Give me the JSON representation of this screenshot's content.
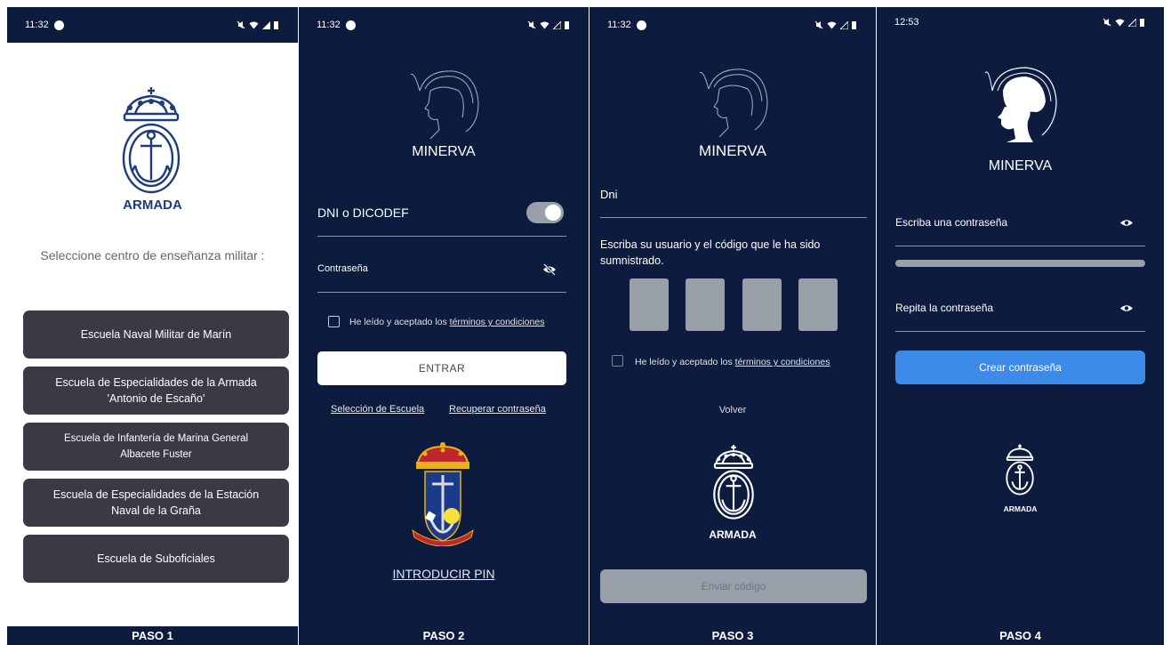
{
  "panels": {
    "p1": {
      "time": "11:32",
      "logo_text": "ARMADA",
      "prompt": "Seleccione centro de enseñanza militar :",
      "schools": [
        "Escuela Naval Militar de Marín",
        "Escuela de Especialidades de la Armada\n'Antonio de Escaño'",
        "Escuela de Infantería de Marina General\nAlbacete Fuster",
        "Escuela de Especialidades de la Estación\nNaval de la Graña",
        "Escuela de Suboficiales"
      ]
    },
    "p2": {
      "time": "11:32",
      "app_name": "MINERVA",
      "user_label": "DNI o DICODEF",
      "password_label": "Contraseña",
      "terms_prefix": "He leído y aceptado los ",
      "terms_link": "términos y condiciones",
      "enter_button": "ENTRAR",
      "school_link": "Selección de Escuela",
      "recover_link": "Recuperar contraseña",
      "pin_link": "INTRODUCIR PIN"
    },
    "p3": {
      "time": "11:32",
      "app_name": "MINERVA",
      "dni_label": "Dni",
      "instructions": "Escriba su usuario y el código que le ha sido sumnistrado.",
      "terms_prefix": "He leído y aceptado los ",
      "terms_link": "términos y condiciones",
      "back_link": "Volver",
      "logo_text": "ARMADA",
      "send_button": "Enviar código"
    },
    "p4": {
      "time": "12:53",
      "app_name": "MINERVA",
      "password_label": "Escriba una contraseña",
      "repeat_label": "Repita la contraseña",
      "create_button": "Crear contraseña",
      "logo_text": "ARMADA"
    }
  },
  "footer": {
    "step1": "PASO 1",
    "step2": "PASO 2",
    "step3": "PASO 3",
    "step4": "PASO 4"
  },
  "colors": {
    "navy": "#0d1b3e",
    "school_button": "#3a3a44",
    "primary_blue": "#3d8be8",
    "code_box": "#9aa0aa"
  }
}
